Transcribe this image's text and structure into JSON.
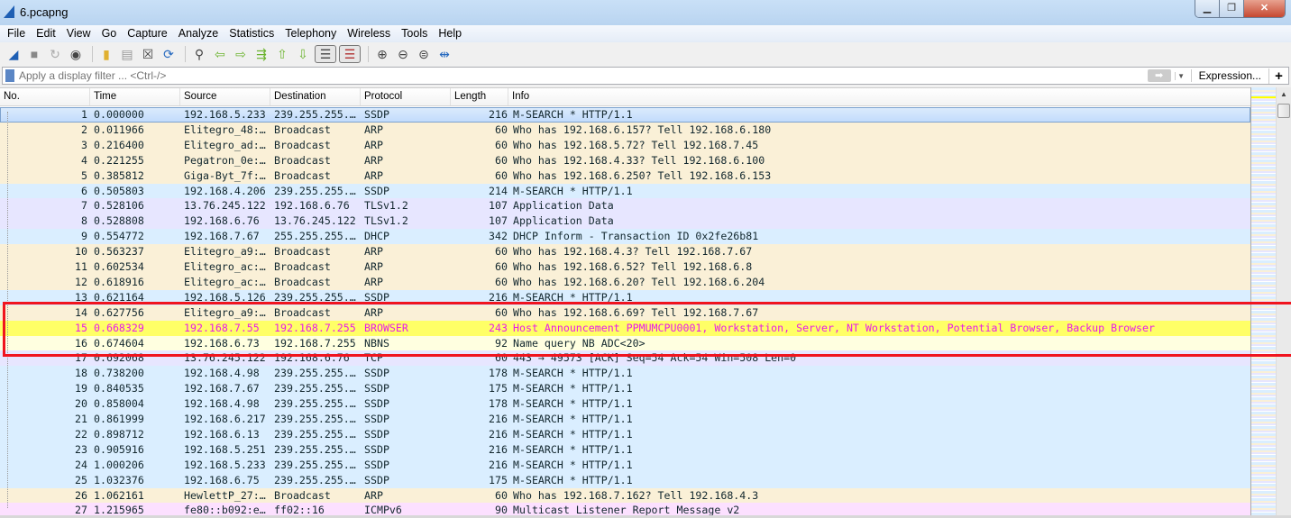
{
  "window": {
    "title": "6.pcapng"
  },
  "menu": [
    "File",
    "Edit",
    "View",
    "Go",
    "Capture",
    "Analyze",
    "Statistics",
    "Telephony",
    "Wireless",
    "Tools",
    "Help"
  ],
  "filter": {
    "placeholder": "Apply a display filter ... <Ctrl-/>",
    "expression_label": "Expression...",
    "add_label": "+"
  },
  "columns": [
    "No.",
    "Time",
    "Source",
    "Destination",
    "Protocol",
    "Length",
    "Info"
  ],
  "colors": {
    "arp": "#faf0d7",
    "udp": "#daeeff",
    "tcp": "#e7e6ff",
    "browser": "#ffff66",
    "nbns": "#ffffe0",
    "icmpv6": "#fce0ff",
    "highlight": "#f0141e"
  },
  "packets": [
    {
      "no": "1",
      "time": "0.000000",
      "src": "192.168.5.233",
      "dst": "239.255.255.…",
      "proto": "SSDP",
      "len": "216",
      "info": "M-SEARCH * HTTP/1.1",
      "cls": "udp",
      "selected": true
    },
    {
      "no": "2",
      "time": "0.011966",
      "src": "Elitegro_48:…",
      "dst": "Broadcast",
      "proto": "ARP",
      "len": "60",
      "info": "Who has 192.168.6.157? Tell 192.168.6.180",
      "cls": "arp"
    },
    {
      "no": "3",
      "time": "0.216400",
      "src": "Elitegro_ad:…",
      "dst": "Broadcast",
      "proto": "ARP",
      "len": "60",
      "info": "Who has 192.168.5.72? Tell 192.168.7.45",
      "cls": "arp"
    },
    {
      "no": "4",
      "time": "0.221255",
      "src": "Pegatron_0e:…",
      "dst": "Broadcast",
      "proto": "ARP",
      "len": "60",
      "info": "Who has 192.168.4.33? Tell 192.168.6.100",
      "cls": "arp"
    },
    {
      "no": "5",
      "time": "0.385812",
      "src": "Giga-Byt_7f:…",
      "dst": "Broadcast",
      "proto": "ARP",
      "len": "60",
      "info": "Who has 192.168.6.250? Tell 192.168.6.153",
      "cls": "arp"
    },
    {
      "no": "6",
      "time": "0.505803",
      "src": "192.168.4.206",
      "dst": "239.255.255.…",
      "proto": "SSDP",
      "len": "214",
      "info": "M-SEARCH * HTTP/1.1",
      "cls": "udp"
    },
    {
      "no": "7",
      "time": "0.528106",
      "src": "13.76.245.122",
      "dst": "192.168.6.76",
      "proto": "TLSv1.2",
      "len": "107",
      "info": "Application Data",
      "cls": "tcp"
    },
    {
      "no": "8",
      "time": "0.528808",
      "src": "192.168.6.76",
      "dst": "13.76.245.122",
      "proto": "TLSv1.2",
      "len": "107",
      "info": "Application Data",
      "cls": "tcp"
    },
    {
      "no": "9",
      "time": "0.554772",
      "src": "192.168.7.67",
      "dst": "255.255.255.…",
      "proto": "DHCP",
      "len": "342",
      "info": "DHCP Inform   - Transaction ID 0x2fe26b81",
      "cls": "udp"
    },
    {
      "no": "10",
      "time": "0.563237",
      "src": "Elitegro_a9:…",
      "dst": "Broadcast",
      "proto": "ARP",
      "len": "60",
      "info": "Who has 192.168.4.3? Tell 192.168.7.67",
      "cls": "arp"
    },
    {
      "no": "11",
      "time": "0.602534",
      "src": "Elitegro_ac:…",
      "dst": "Broadcast",
      "proto": "ARP",
      "len": "60",
      "info": "Who has 192.168.6.52? Tell 192.168.6.8",
      "cls": "arp"
    },
    {
      "no": "12",
      "time": "0.618916",
      "src": "Elitegro_ac:…",
      "dst": "Broadcast",
      "proto": "ARP",
      "len": "60",
      "info": "Who has 192.168.6.20? Tell 192.168.6.204",
      "cls": "arp"
    },
    {
      "no": "13",
      "time": "0.621164",
      "src": "192.168.5.126",
      "dst": "239.255.255.…",
      "proto": "SSDP",
      "len": "216",
      "info": "M-SEARCH * HTTP/1.1",
      "cls": "udp"
    },
    {
      "no": "14",
      "time": "0.627756",
      "src": "Elitegro_a9:…",
      "dst": "Broadcast",
      "proto": "ARP",
      "len": "60",
      "info": "Who has 192.168.6.69? Tell 192.168.7.67",
      "cls": "arp"
    },
    {
      "no": "15",
      "time": "0.668329",
      "src": "192.168.7.55",
      "dst": "192.168.7.255",
      "proto": "BROWSER",
      "len": "243",
      "info": "Host Announcement PPMUMCPU0001, Workstation, Server, NT Workstation, Potential Browser, Backup Browser",
      "cls": "browser"
    },
    {
      "no": "16",
      "time": "0.674604",
      "src": "192.168.6.73",
      "dst": "192.168.7.255",
      "proto": "NBNS",
      "len": "92",
      "info": "Name query NB ADC<20>",
      "cls": "nbns"
    },
    {
      "no": "17",
      "time": "0.692068",
      "src": "13.76.245.122",
      "dst": "192.168.6.76",
      "proto": "TCP",
      "len": "60",
      "info": "443 → 49573 [ACK] Seq=54 Ack=54 Win=508 Len=0",
      "cls": "tcp"
    },
    {
      "no": "18",
      "time": "0.738200",
      "src": "192.168.4.98",
      "dst": "239.255.255.…",
      "proto": "SSDP",
      "len": "178",
      "info": "M-SEARCH * HTTP/1.1",
      "cls": "udp"
    },
    {
      "no": "19",
      "time": "0.840535",
      "src": "192.168.7.67",
      "dst": "239.255.255.…",
      "proto": "SSDP",
      "len": "175",
      "info": "M-SEARCH * HTTP/1.1",
      "cls": "udp"
    },
    {
      "no": "20",
      "time": "0.858004",
      "src": "192.168.4.98",
      "dst": "239.255.255.…",
      "proto": "SSDP",
      "len": "178",
      "info": "M-SEARCH * HTTP/1.1",
      "cls": "udp"
    },
    {
      "no": "21",
      "time": "0.861999",
      "src": "192.168.6.217",
      "dst": "239.255.255.…",
      "proto": "SSDP",
      "len": "216",
      "info": "M-SEARCH * HTTP/1.1",
      "cls": "udp"
    },
    {
      "no": "22",
      "time": "0.898712",
      "src": "192.168.6.13",
      "dst": "239.255.255.…",
      "proto": "SSDP",
      "len": "216",
      "info": "M-SEARCH * HTTP/1.1",
      "cls": "udp"
    },
    {
      "no": "23",
      "time": "0.905916",
      "src": "192.168.5.251",
      "dst": "239.255.255.…",
      "proto": "SSDP",
      "len": "216",
      "info": "M-SEARCH * HTTP/1.1",
      "cls": "udp"
    },
    {
      "no": "24",
      "time": "1.000206",
      "src": "192.168.5.233",
      "dst": "239.255.255.…",
      "proto": "SSDP",
      "len": "216",
      "info": "M-SEARCH * HTTP/1.1",
      "cls": "udp"
    },
    {
      "no": "25",
      "time": "1.032376",
      "src": "192.168.6.75",
      "dst": "239.255.255.…",
      "proto": "SSDP",
      "len": "175",
      "info": "M-SEARCH * HTTP/1.1",
      "cls": "udp"
    },
    {
      "no": "26",
      "time": "1.062161",
      "src": "HewlettP_27:…",
      "dst": "Broadcast",
      "proto": "ARP",
      "len": "60",
      "info": "Who has 192.168.7.162? Tell 192.168.4.3",
      "cls": "arp"
    },
    {
      "no": "27",
      "time": "1.215965",
      "src": "fe80::b092:e…",
      "dst": "ff02::16",
      "proto": "ICMPv6",
      "len": "90",
      "info": "Multicast Listener Report Message v2",
      "cls": "icmpv6"
    }
  ]
}
